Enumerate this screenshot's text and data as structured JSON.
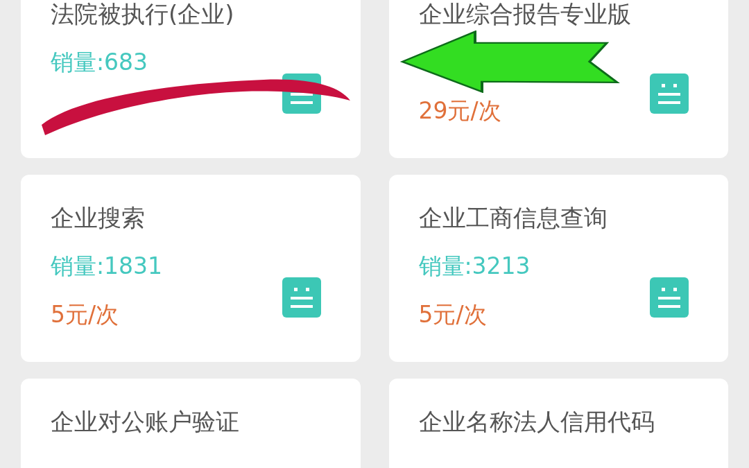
{
  "cards": [
    {
      "title": "法院被执行(企业)",
      "sales": "销量:683"
    },
    {
      "title": "企业综合报告专业版",
      "price": "29元/次"
    },
    {
      "title": "企业搜索",
      "sales": "销量:1831",
      "price": "5元/次"
    },
    {
      "title": "企业工商信息查询",
      "sales": "销量:3213",
      "price": "5元/次"
    },
    {
      "title": "企业对公账户验证"
    },
    {
      "title": "企业名称法人信用代码"
    }
  ],
  "scribble": true,
  "arrow": true
}
